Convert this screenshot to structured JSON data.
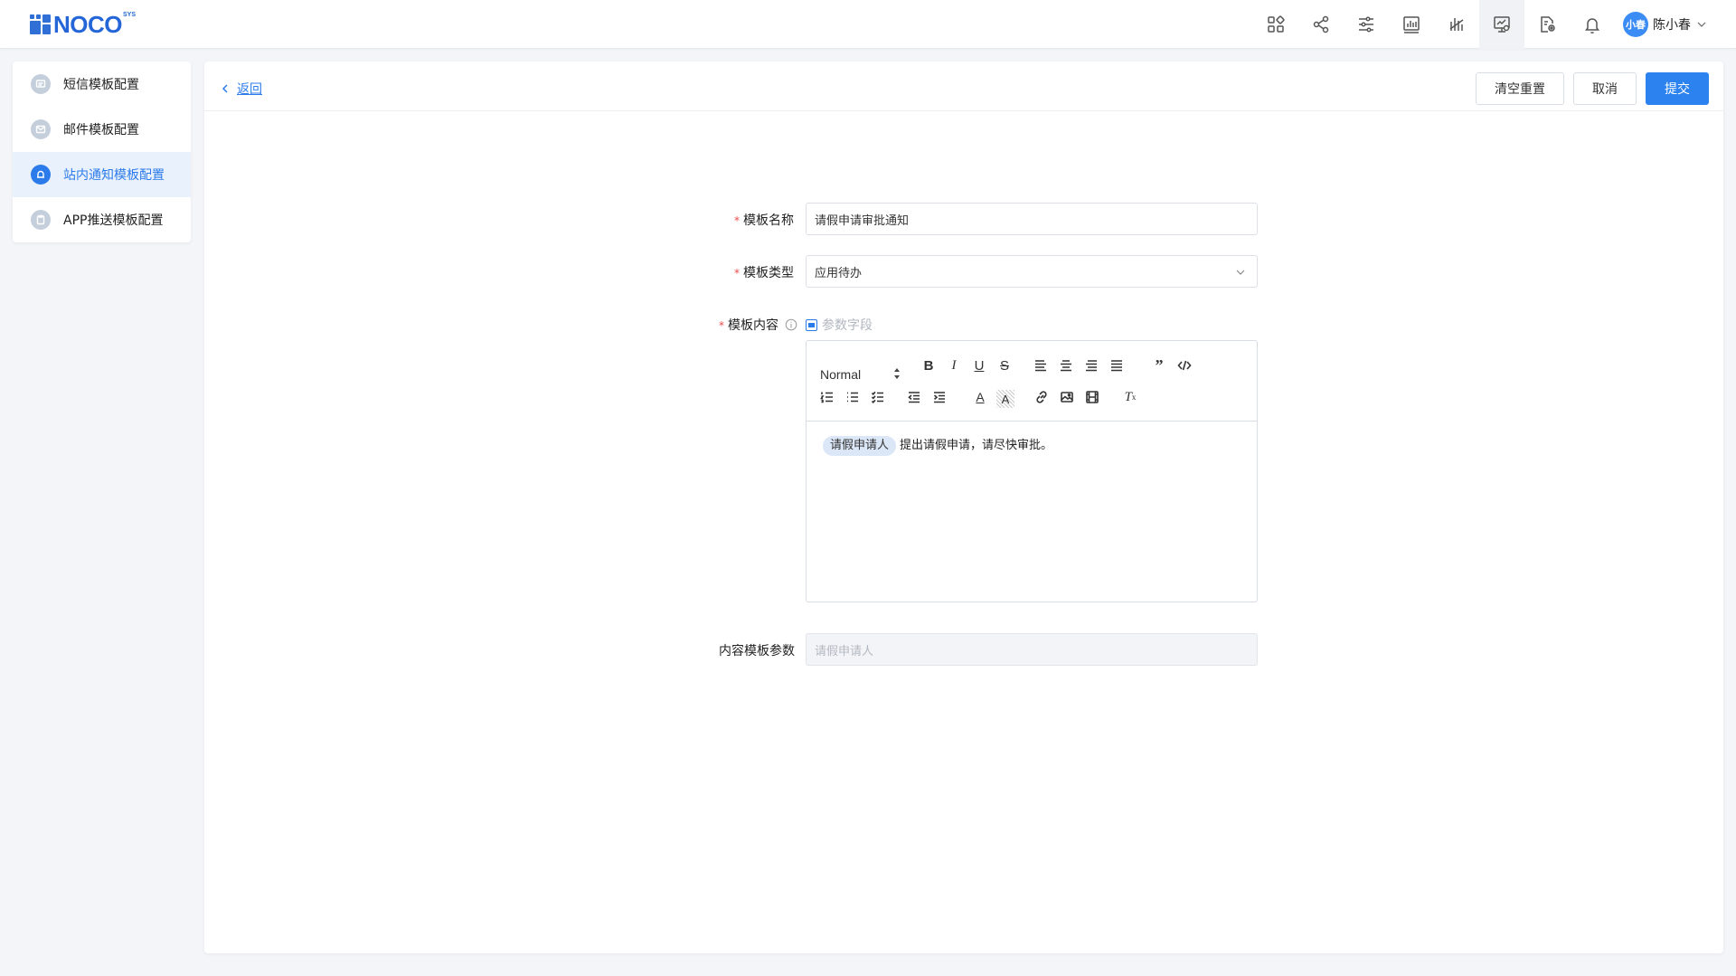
{
  "header": {
    "logo_text": "NOCO",
    "logo_sup": "SYS",
    "icons": [
      "apps-icon",
      "share-icon",
      "sliders-icon",
      "bar-chart-icon",
      "analytics-icon",
      "monitor-config-icon",
      "document-settings-icon",
      "bell-icon"
    ],
    "active_icon_index": 5,
    "user": {
      "avatar_text": "小春",
      "name": "陈小春"
    }
  },
  "sidebar": {
    "items": [
      {
        "label": "短信模板配置",
        "icon": "message-icon"
      },
      {
        "label": "邮件模板配置",
        "icon": "mail-icon"
      },
      {
        "label": "站内通知模板配置",
        "icon": "bell-icon"
      },
      {
        "label": "APP推送模板配置",
        "icon": "clipboard-icon"
      }
    ],
    "active_index": 2
  },
  "main": {
    "back_label": "返回",
    "buttons": {
      "reset": "清空重置",
      "cancel": "取消",
      "submit": "提交"
    },
    "form": {
      "name_label": "模板名称",
      "name_value": "请假申请审批通知",
      "type_label": "模板类型",
      "type_value": "应用待办",
      "content_label": "模板内容",
      "param_link": "参数字段",
      "editor": {
        "heading_select": "Normal",
        "chip": "请假申请人",
        "text": "提出请假申请，请尽快审批。"
      },
      "params_label": "内容模板参数",
      "params_value": "请假申请人"
    }
  },
  "colors": {
    "accent": "#2c83f0",
    "required": "#f04b4b",
    "sidebar_active_bg": "#e9f1fc"
  }
}
